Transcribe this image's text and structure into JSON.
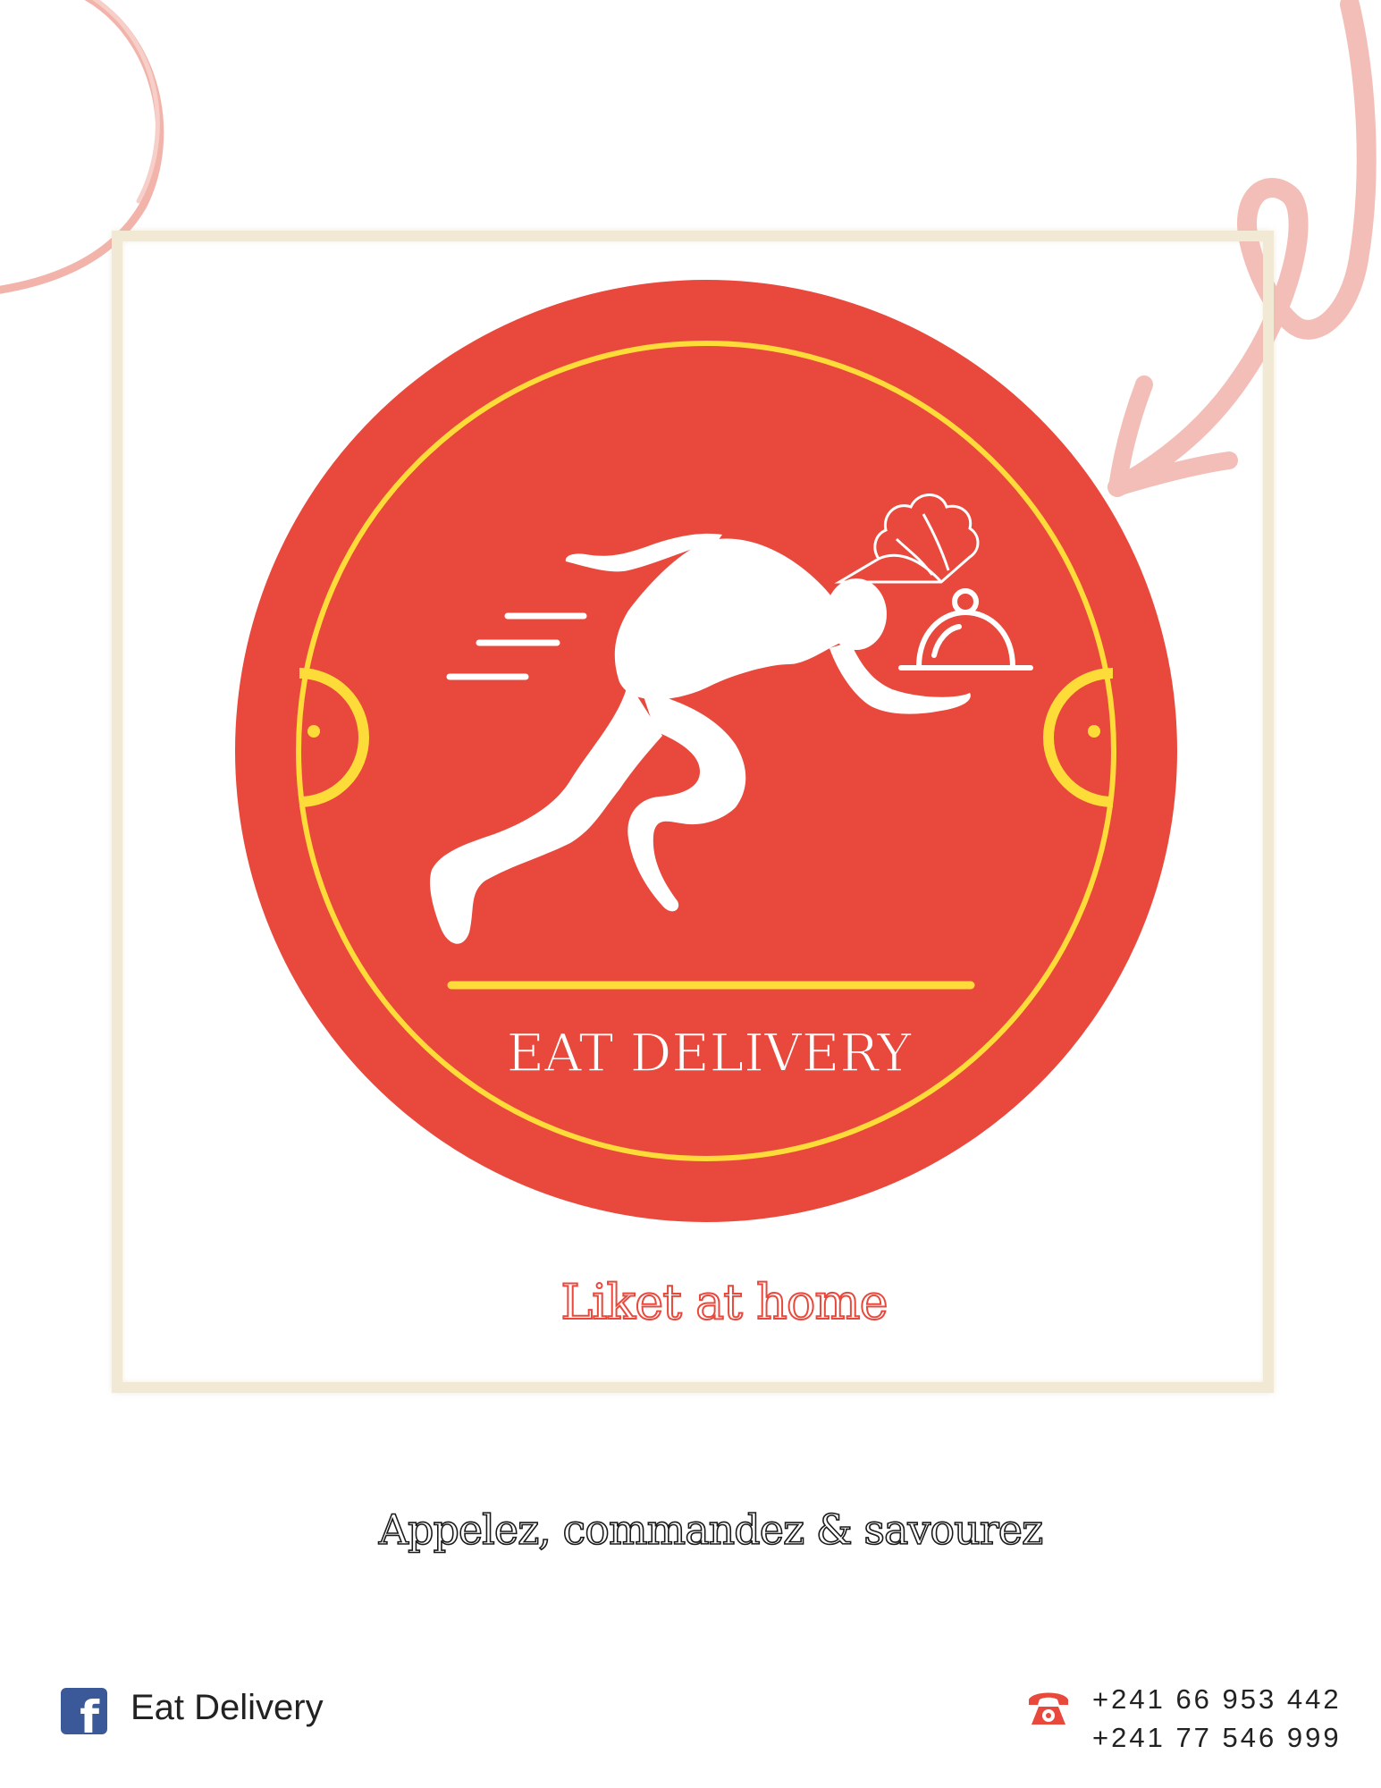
{
  "brand": {
    "name": "EAT DELIVERY",
    "tagline": "Liket at home"
  },
  "slogan": "Appelez, commandez & savourez",
  "footer": {
    "facebook": {
      "icon": "facebook-icon",
      "label": "Eat Delivery"
    },
    "phone": {
      "icon": "telephone-icon",
      "numbers": [
        "+241 66 953 442",
        "+241 77 546 999"
      ]
    }
  },
  "colors": {
    "brand_red": "#e8493c",
    "accent_yellow": "#fddc39",
    "decoration_pink": "#f2b3ab",
    "frame_beige": "#f1e9d3",
    "facebook_blue": "#3b5998"
  }
}
